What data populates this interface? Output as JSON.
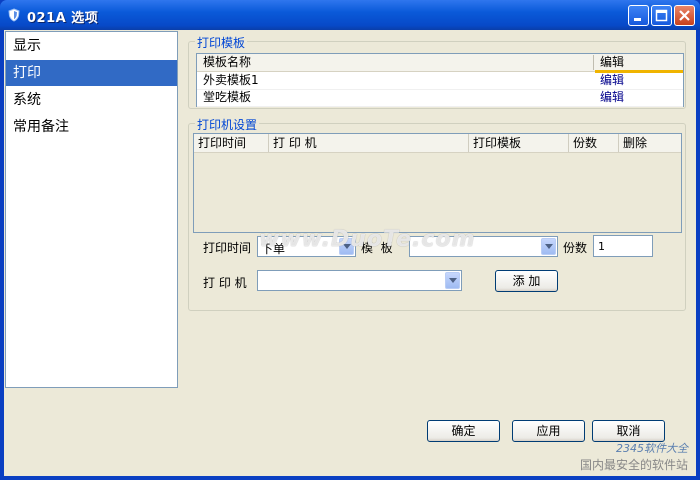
{
  "window": {
    "title": "021A 选项",
    "title_icon": "shield-icon",
    "colors": {
      "titlebar": "#0a5ad9",
      "selected": "#316ac5",
      "group_legend": "#0046d5"
    }
  },
  "sidebar": {
    "items": [
      {
        "label": "显示",
        "selected": false
      },
      {
        "label": "打印",
        "selected": true
      },
      {
        "label": "系统",
        "selected": false
      },
      {
        "label": "常用备注",
        "selected": false
      }
    ]
  },
  "print_template": {
    "legend": "打印模板",
    "columns": [
      "模板名称",
      "编辑"
    ],
    "rows": [
      {
        "name": "外卖模板1",
        "edit": "编辑"
      },
      {
        "name": "堂吃模板",
        "edit": "编辑"
      }
    ]
  },
  "printer_settings": {
    "legend": "打印机设置",
    "columns": [
      "打印时间",
      "打 印 机",
      "打印模板",
      "份数",
      "删除"
    ],
    "print_time_label": "打印时间",
    "print_time_value": "下单",
    "template_label": "模  板",
    "template_value": "",
    "copies_label": "份数",
    "copies_value": "1",
    "printer_label": "打 印 机",
    "printer_value": "",
    "add_button": "添 加"
  },
  "footer": {
    "ok": "确定",
    "apply": "应用",
    "cancel": "取消"
  },
  "watermarks": {
    "main": "www.DuoTe.com",
    "brand": "2345软件大全",
    "slogan": "国内最安全的软件站"
  }
}
